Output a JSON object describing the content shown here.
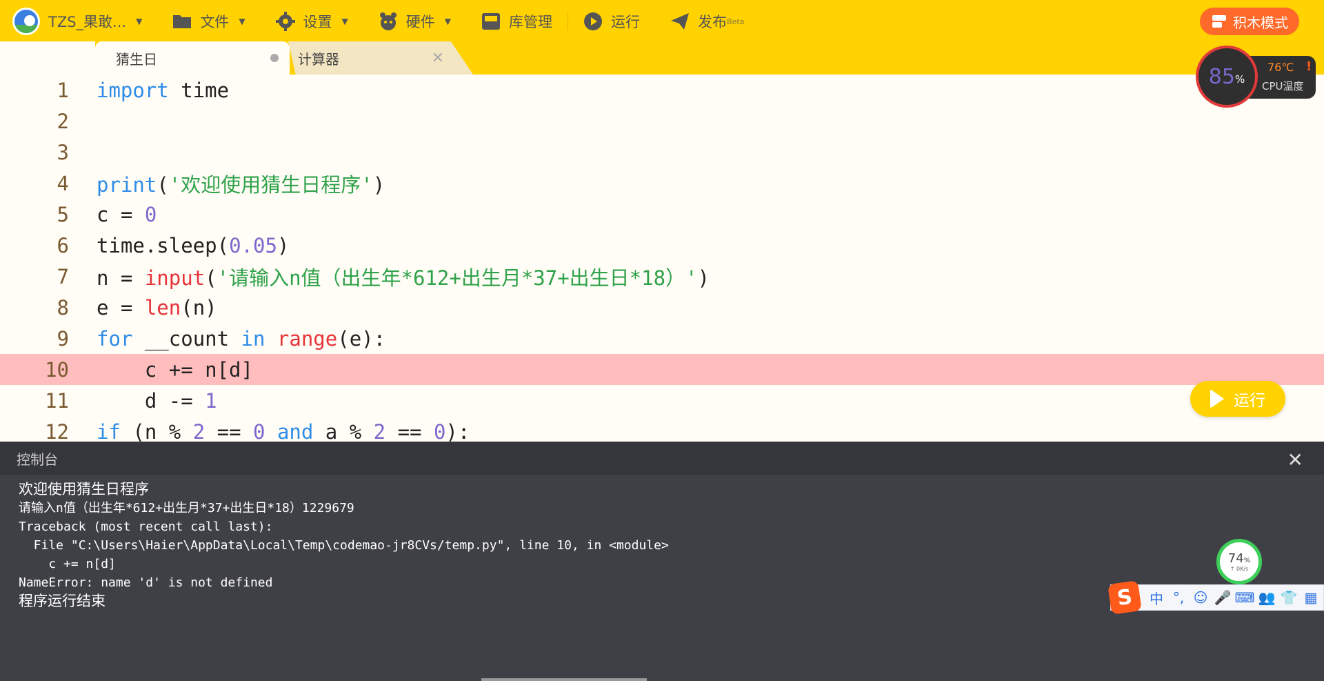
{
  "menu": {
    "user": "TZS_果敢...",
    "file": "文件",
    "settings": "设置",
    "hardware": "硬件",
    "library": "库管理",
    "run": "运行",
    "publish": "发布",
    "publish_badge": "Beta"
  },
  "blocks_mode": "积木模式",
  "tabs": [
    {
      "label": "猜生日"
    },
    {
      "label": "计算器"
    }
  ],
  "cpu": {
    "usage": "85",
    "usage_unit": "%",
    "temp": "76℃",
    "label": "CPU温度",
    "warn": "!"
  },
  "editor": {
    "line_numbers": [
      "1",
      "2",
      "3",
      "4",
      "5",
      "6",
      "7",
      "8",
      "9",
      "10",
      "11",
      "12"
    ],
    "highlight_line": 10
  },
  "run_button": "运行",
  "console": {
    "title": "控制台",
    "close": "✕",
    "lines": [
      "欢迎使用猜生日程序",
      "请输入n值（出生年*612+出生月*37+出生日*18）1229679",
      "Traceback (most recent call last):",
      "  File \"C:\\Users\\Haier\\AppData\\Local\\Temp\\codemao-jr8CVs/temp.py\", line 10, in <module>",
      "    c += n[d]",
      "NameError: name 'd' is not defined",
      "程序运行结束"
    ]
  },
  "net": {
    "value": "74",
    "unit": "%",
    "speed": "↑ 0K/s"
  },
  "ime": {
    "logo": "S",
    "items": [
      "中",
      "°,",
      "☺",
      "🎤",
      "⌨",
      "👥",
      "👕",
      "▦"
    ]
  },
  "colors": {
    "topbar": "#ffd200",
    "keyword": "#2f8ce8",
    "builtin": "#e8323a",
    "string": "#2fa24a",
    "number": "#7b68cc",
    "error_line": "#ffbdbd",
    "console_bg": "#3f4046"
  }
}
